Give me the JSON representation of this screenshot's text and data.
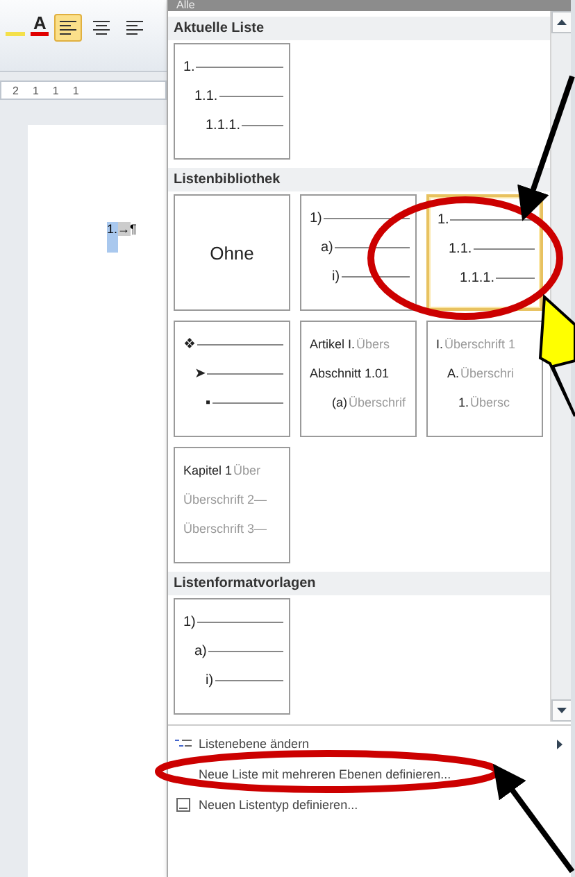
{
  "ribbon": {
    "font_color_letter": "A",
    "align_buttons": [
      {
        "selected": true
      },
      {
        "selected": false
      },
      {
        "selected": false
      }
    ]
  },
  "ruler": {
    "marks": [
      "2",
      "1",
      "1",
      "1"
    ]
  },
  "document": {
    "list_number": "1.",
    "tab_mark": "→",
    "pilcrow": "¶"
  },
  "panel": {
    "filter": "Alle",
    "sections": [
      {
        "title": "Aktuelle Liste",
        "tiles": [
          {
            "kind": "levels",
            "selected": false,
            "rows": [
              {
                "label": "1."
              },
              {
                "label": "1.1."
              },
              {
                "label": "1.1.1."
              }
            ]
          }
        ]
      },
      {
        "title": "Listenbibliothek",
        "tiles": [
          {
            "kind": "label",
            "selected": false,
            "label": "Ohne"
          },
          {
            "kind": "levels",
            "selected": false,
            "rows": [
              {
                "label": "1)"
              },
              {
                "label": "a)"
              },
              {
                "label": "i)"
              }
            ]
          },
          {
            "kind": "levels",
            "selected": true,
            "rows": [
              {
                "label": "1."
              },
              {
                "label": "1.1."
              },
              {
                "label": "1.1.1."
              }
            ]
          },
          {
            "kind": "levels",
            "selected": false,
            "rows": [
              {
                "label": "❖"
              },
              {
                "label": "➤"
              },
              {
                "label": "▪"
              }
            ]
          },
          {
            "kind": "headings",
            "selected": false,
            "rows": [
              {
                "label": "Artikel I.",
                "text": "Übers"
              },
              {
                "label": "Abschnitt 1.01",
                "text": ""
              },
              {
                "label": "(a)",
                "text": "Überschrif"
              }
            ]
          },
          {
            "kind": "headings",
            "selected": false,
            "rows": [
              {
                "label": "I.",
                "text": "Überschrift 1"
              },
              {
                "label": "A.",
                "text": "Überschri"
              },
              {
                "label": "1.",
                "text": "Übersc"
              }
            ]
          },
          {
            "kind": "headings",
            "selected": false,
            "rows": [
              {
                "label": "Kapitel 1",
                "text": "Über"
              },
              {
                "label": "",
                "text": "Überschrift 2—"
              },
              {
                "label": "",
                "text": "Überschrift 3—"
              }
            ]
          }
        ]
      },
      {
        "title": "Listenformatvorlagen",
        "tiles": [
          {
            "kind": "levels",
            "selected": false,
            "rows": [
              {
                "label": "1)"
              },
              {
                "label": "a)"
              },
              {
                "label": "i)"
              }
            ]
          }
        ]
      }
    ],
    "menu": [
      {
        "kind": "levels",
        "label": "Listenebene ändern",
        "submenu": true
      },
      {
        "kind": "plain",
        "label": "Neue Liste mit mehreren Ebenen definieren...",
        "submenu": false
      },
      {
        "kind": "style",
        "label": "Neuen Listentyp definieren...",
        "submenu": false
      }
    ]
  }
}
